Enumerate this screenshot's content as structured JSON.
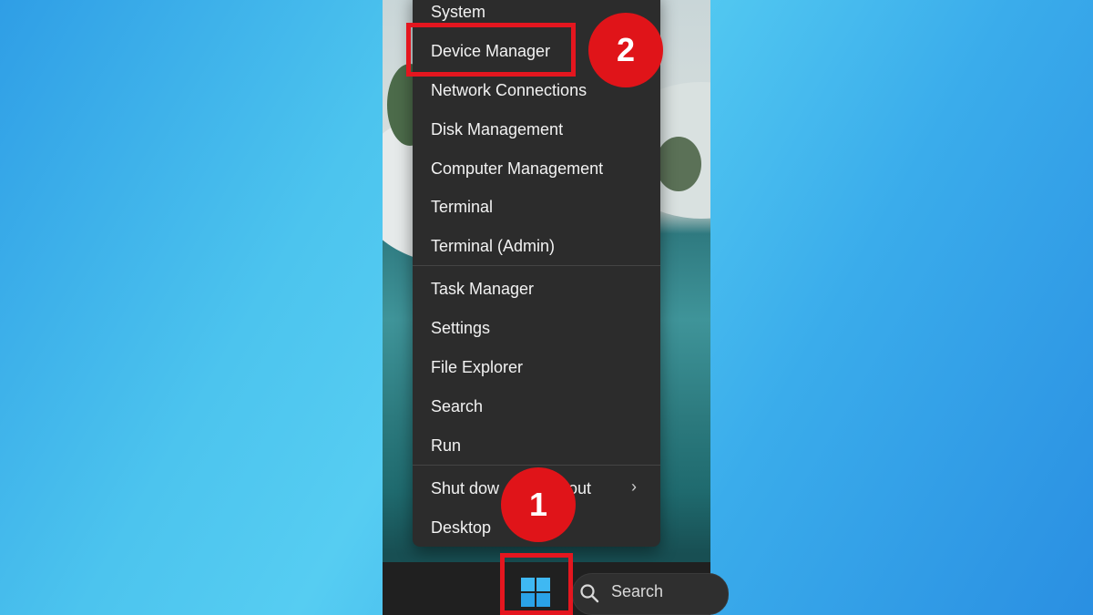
{
  "menu": {
    "items": [
      {
        "label": "System"
      },
      {
        "label": "Device Manager"
      },
      {
        "label": "Network Connections"
      },
      {
        "label": "Disk Management"
      },
      {
        "label": "Computer Management"
      },
      {
        "label": "Terminal"
      },
      {
        "label": "Terminal (Admin)"
      },
      {
        "label": "Task Manager"
      },
      {
        "label": "Settings"
      },
      {
        "label": "File Explorer"
      },
      {
        "label": "Search"
      },
      {
        "label": "Run"
      },
      {
        "label": "Shut down or sign out",
        "visible_text": "Shut dow",
        "visible_tail": "out",
        "has_submenu": true
      },
      {
        "label": "Desktop"
      }
    ],
    "submenu_chevron": "›"
  },
  "taskbar": {
    "start_button_icon": "windows-logo-icon",
    "search_label": "Search",
    "search_icon": "search-icon"
  },
  "annotations": {
    "step1": "1",
    "step2": "2",
    "color": "#e01419"
  }
}
